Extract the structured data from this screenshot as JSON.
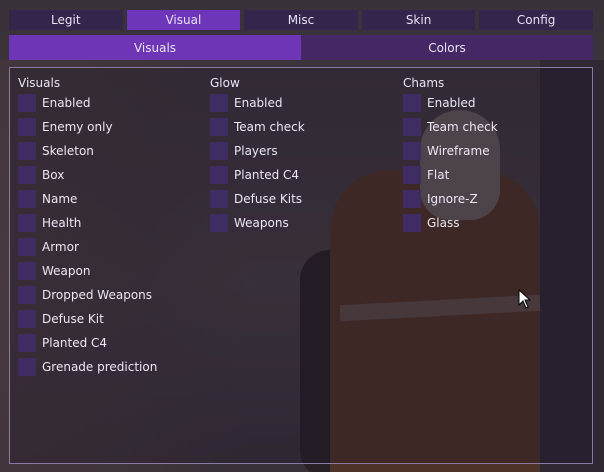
{
  "tabs": [
    {
      "label": "Legit",
      "active": false
    },
    {
      "label": "Visual",
      "active": true
    },
    {
      "label": "Misc",
      "active": false
    },
    {
      "label": "Skin",
      "active": false
    },
    {
      "label": "Config",
      "active": false
    }
  ],
  "subtabs": [
    {
      "label": "Visuals",
      "active": true
    },
    {
      "label": "Colors",
      "active": false
    }
  ],
  "columns": [
    {
      "title": "Visuals",
      "items": [
        "Enabled",
        "Enemy only",
        "Skeleton",
        "Box",
        "Name",
        "Health",
        "Armor",
        "Weapon",
        "Dropped Weapons",
        "Defuse Kit",
        "Planted C4",
        "Grenade prediction"
      ]
    },
    {
      "title": "Glow",
      "items": [
        "Enabled",
        "Team check",
        "Players",
        "Planted C4",
        "Defuse Kits",
        "Weapons"
      ]
    },
    {
      "title": "Chams",
      "items": [
        "Enabled",
        "Team check",
        "Wireframe",
        "Flat",
        "Ignore-Z",
        "Glass"
      ]
    }
  ],
  "colors": {
    "accent": "#6d35b9",
    "checkbox": "#3e2c62",
    "border": "#8a79a2"
  }
}
